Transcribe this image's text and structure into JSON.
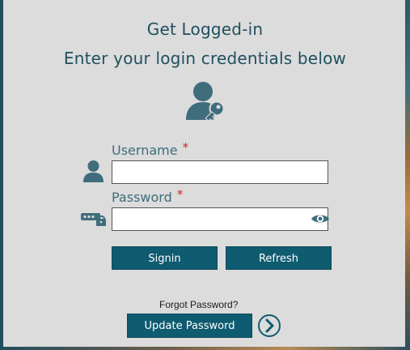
{
  "header": {
    "title": "Get Logged-in",
    "subtitle": "Enter your login credentials below",
    "icon": "user-key-icon"
  },
  "form": {
    "username": {
      "label": "Username",
      "required_mark": "*",
      "value": "",
      "icon": "user-icon"
    },
    "password": {
      "label": "Password",
      "required_mark": "*",
      "value": "",
      "icon": "password-lock-icon",
      "toggle_icon": "eye-icon"
    }
  },
  "buttons": {
    "signin": "Signin",
    "refresh": "Refresh",
    "update_password": "Update Password"
  },
  "links": {
    "forgot_password": "Forgot Password?"
  },
  "colors": {
    "accent": "#0f5b70",
    "panel": "#dcdcdc",
    "required": "#d61f1f",
    "icon": "#3f6d7b"
  }
}
